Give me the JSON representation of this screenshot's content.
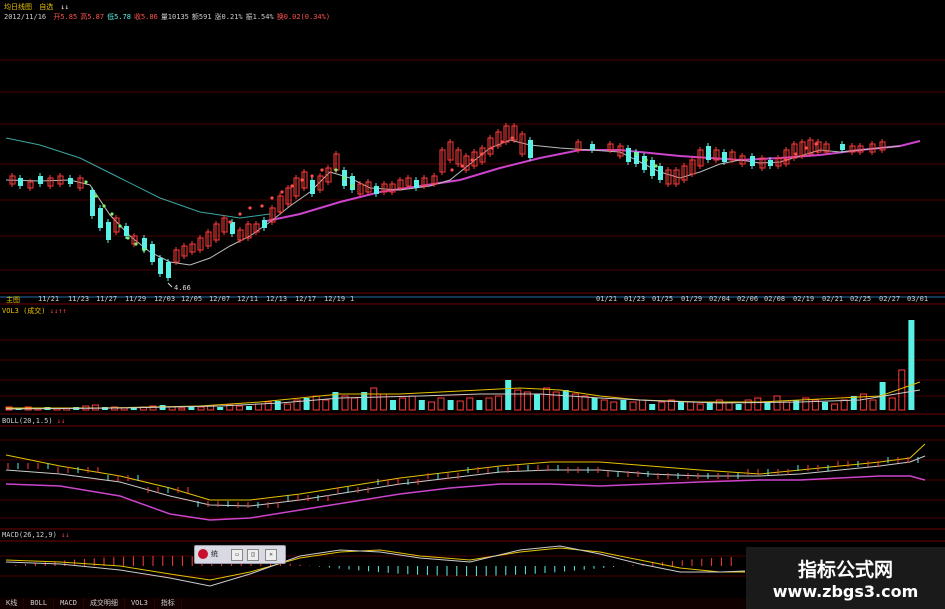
{
  "colors": {
    "up": "#ff3b3b",
    "down": "#59f0e6",
    "ma_main": "#cc44cc",
    "ma_trend": "#3aa6a0",
    "text_label": "#e6c200",
    "axis": "#2a6aa8",
    "grid": "#4a0000"
  },
  "header": {
    "title": "均日线图",
    "subtitle": "自选",
    "arrows": "↓↓",
    "date": "2012/11/16",
    "fields": [
      {
        "label": "开",
        "value": "5.85"
      },
      {
        "label": "高",
        "value": "5.87"
      },
      {
        "label": "低",
        "value": "5.78"
      },
      {
        "label": "收",
        "value": "5.86"
      },
      {
        "label": "量",
        "value": "10135"
      },
      {
        "label": "额",
        "value": "591"
      },
      {
        "label": "涨",
        "value": "0.21%"
      },
      {
        "label": "振",
        "value": "1.54%"
      },
      {
        "label": "换",
        "value": "0.02(0.34%)"
      }
    ]
  },
  "price_chart": {
    "low_marker": "4.66",
    "dates_left": [
      "11/21",
      "11/23",
      "11/27",
      "11/29",
      "12/03",
      "12/05",
      "12/07",
      "12/11",
      "12/13",
      "12/17",
      "12/19"
    ],
    "dates_right": [
      "01/21",
      "01/23",
      "01/25",
      "01/29",
      "02/04",
      "02/06",
      "02/08",
      "02/19",
      "02/21",
      "02/25",
      "02/27",
      "03/01"
    ],
    "date_prefix": "主图",
    "date_suffix": "1"
  },
  "volume_panel": {
    "label": "VOL3 (成交)",
    "arrows": "↓↓↑↑"
  },
  "boll_panel": {
    "label": "BOLL(20,1.5)",
    "arrows": "↓↓"
  },
  "macd_panel": {
    "label": "MACD(26,12,9)",
    "arrows": "↓↓"
  },
  "bottom_tabs": [
    "K线",
    "BOLL",
    "MACD",
    "成交明细",
    "VOL3",
    "指标"
  ],
  "popup": {
    "title": "统",
    "buttons": [
      "▭",
      "◫",
      "✕"
    ]
  },
  "watermark": {
    "line1": "指标公式网",
    "line2": "www.zbgs3.com"
  }
}
